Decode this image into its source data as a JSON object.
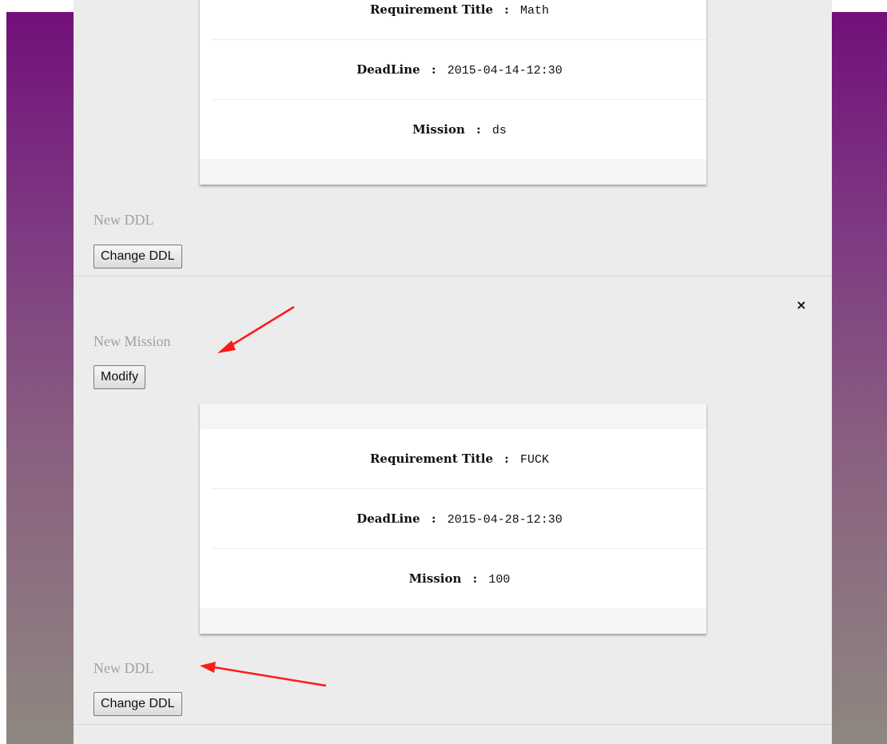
{
  "missions": [
    {
      "requirement_label": "Requirement Title",
      "requirement_value": "Math",
      "deadline_label": "DeadLine",
      "deadline_value": "2015-04-14-12:30",
      "mission_label": "Mission",
      "mission_value": "ds",
      "new_ddl_label": "New DDL",
      "change_ddl_button": "Change DDL"
    },
    {
      "close_icon": "×",
      "new_mission_label": "New Mission",
      "modify_button": "Modify",
      "requirement_label": "Requirement Title",
      "requirement_value": "FUCK",
      "deadline_label": "DeadLine",
      "deadline_value": "2015-04-28-12:30",
      "mission_label": "Mission",
      "mission_value": "100",
      "new_ddl_label": "New DDL",
      "change_ddl_button": "Change DDL"
    }
  ],
  "separator": ":",
  "colors": {
    "panel": "#ececec",
    "gradient_top": "#72107a",
    "gradient_bottom": "#8e8780",
    "annotation_arrow": "#ff0000"
  }
}
